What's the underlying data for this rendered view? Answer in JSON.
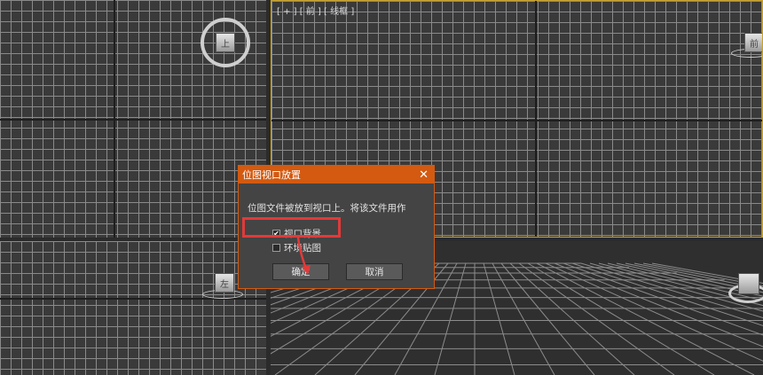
{
  "viewports": {
    "front_label": "[ + ] [ 前 ] [ 线框 ]",
    "top_cube_label": "上",
    "front_cube_label": "前",
    "left_cube_label": "左"
  },
  "dialog": {
    "title": "位图视口放置",
    "close_glyph": "✕",
    "message": "位图文件被放到视口上。将该文件用作",
    "options": [
      {
        "label": "视口背景",
        "checked": true,
        "check_glyph": "✔"
      },
      {
        "label": "环境贴图",
        "checked": false
      }
    ],
    "ok_label": "确定",
    "cancel_label": "取消"
  },
  "colors": {
    "dialog_accent": "#d35a10",
    "highlight": "#e23a3a",
    "active_viewport_border": "#c9a227"
  }
}
